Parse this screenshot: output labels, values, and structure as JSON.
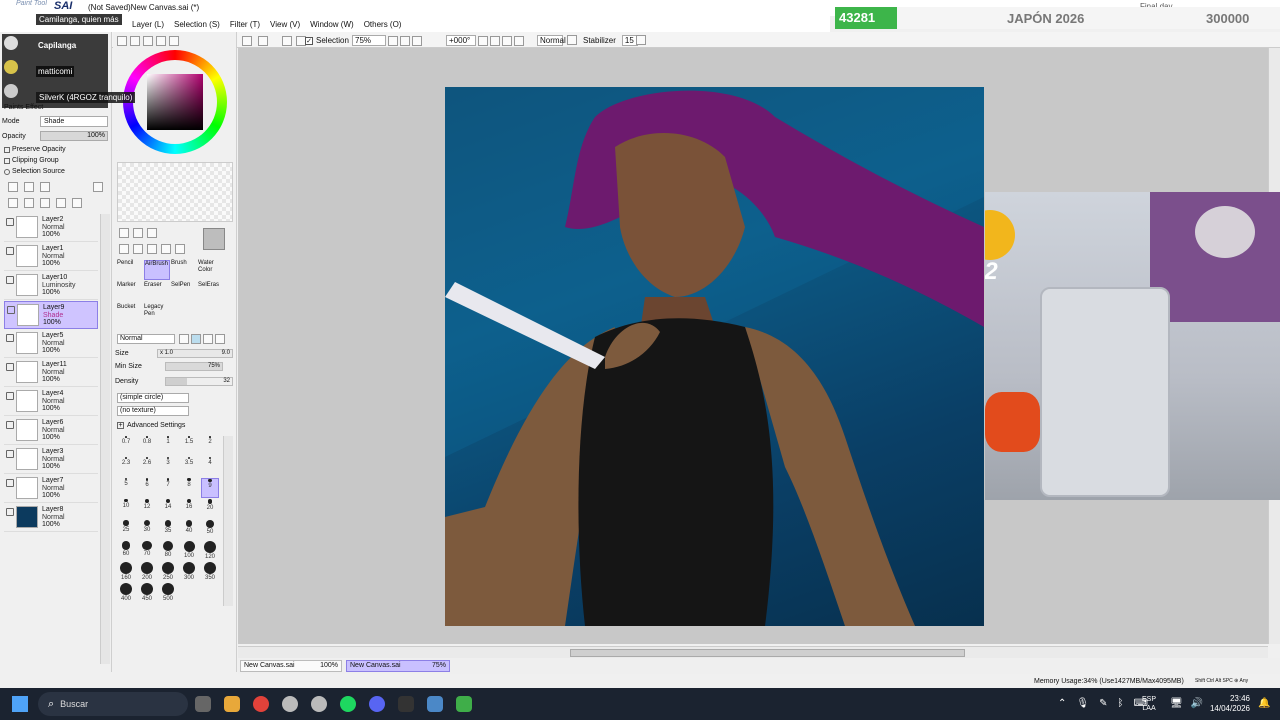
{
  "window": {
    "app_name": "SAI",
    "app_prefix": "Paint Tool",
    "title": "(Not Saved)New Canvas.sai (*)",
    "chat_top_right": "Final day"
  },
  "menu": [
    "Layer (L)",
    "Selection (S)",
    "Filter (T)",
    "View (V)",
    "Window (W)",
    "Others (O)"
  ],
  "toolbar": {
    "selection_label": "Selection",
    "zoom": "75%",
    "rotation": "+000°",
    "blend_mode": "Normal",
    "stabilizer_label": "Stabilizer",
    "stabilizer_value": "15"
  },
  "stream_overlay": {
    "count": "43281",
    "title": "JAPÓN 2026",
    "goal": "300000",
    "accent": "#3db54a"
  },
  "chat": [
    {
      "user": "Camilanga, quien más"
    },
    {
      "user": "Capilanga"
    },
    {
      "user": "matticomi"
    },
    {
      "user": "SilverK (4RGOZ tranquilo)"
    }
  ],
  "layer_panel": {
    "effect_label": "Paints Effect",
    "mode_label": "Mode",
    "mode_value": "Shade",
    "opacity_label": "Opacity",
    "opacity_value": "100%",
    "preserve_opacity": "Preserve Opacity",
    "clipping_group": "Clipping Group",
    "selection_source": "Selection Source",
    "layers": [
      {
        "name": "Layer2",
        "mode": "Normal",
        "opacity": "100%",
        "selected": false
      },
      {
        "name": "Layer1",
        "mode": "Normal",
        "opacity": "100%",
        "selected": false
      },
      {
        "name": "Layer10",
        "mode": "Luminosity",
        "opacity": "100%",
        "selected": false
      },
      {
        "name": "Layer9",
        "mode": "Shade",
        "opacity": "100%",
        "selected": true
      },
      {
        "name": "Layer5",
        "mode": "Normal",
        "opacity": "100%",
        "selected": false
      },
      {
        "name": "Layer11",
        "mode": "Normal",
        "opacity": "100%",
        "selected": false
      },
      {
        "name": "Layer4",
        "mode": "Normal",
        "opacity": "100%",
        "selected": false
      },
      {
        "name": "Layer6",
        "mode": "Normal",
        "opacity": "100%",
        "selected": false
      },
      {
        "name": "Layer3",
        "mode": "Normal",
        "opacity": "100%",
        "selected": false
      },
      {
        "name": "Layer7",
        "mode": "Normal",
        "opacity": "100%",
        "selected": false
      },
      {
        "name": "Layer8",
        "mode": "Normal",
        "opacity": "100%",
        "selected": false
      }
    ]
  },
  "tools": {
    "row1": [
      "Pencil",
      "AirBrush",
      "Brush",
      "Water Color"
    ],
    "row2": [
      "Marker",
      "Eraser",
      "SelPen",
      "SelEras"
    ],
    "row3": [
      "Bucket",
      "Legacy Pen"
    ],
    "brush_mode": "Normal",
    "size_label": "Size",
    "size_mult": "x 1.0",
    "size_value": "9.0",
    "min_size_label": "Min Size",
    "min_size_value": "75%",
    "density_label": "Density",
    "density_value": "32",
    "shape": "(simple circle)",
    "texture": "(no texture)",
    "advanced": "Advanced Settings",
    "brush_sizes": [
      "0.7",
      "0.8",
      "1",
      "1.5",
      "2",
      "2.3",
      "2.6",
      "3",
      "3.5",
      "4",
      "5",
      "6",
      "7",
      "8",
      "9",
      "10",
      "12",
      "14",
      "16",
      "20",
      "25",
      "30",
      "35",
      "40",
      "50",
      "60",
      "70",
      "80",
      "100",
      "120",
      "160",
      "200",
      "250",
      "300",
      "350",
      "400",
      "450",
      "500"
    ]
  },
  "tabs": [
    {
      "name": "New Canvas.sai",
      "zoom": "100%",
      "active": false
    },
    {
      "name": "New Canvas.sai",
      "zoom": "75%",
      "active": true
    }
  ],
  "status": {
    "memory": "Memory Usage:34% (Use1427MB/Max4095MB)",
    "keys": "Shift Ctrl Alt SPC ⊕ Any"
  },
  "taskbar": {
    "search_placeholder": "Buscar",
    "lang1": "ESP",
    "lang2": "LAA",
    "time": "23:46",
    "date": "14/04/2026"
  },
  "webcam": {
    "emote_text": "x2"
  }
}
